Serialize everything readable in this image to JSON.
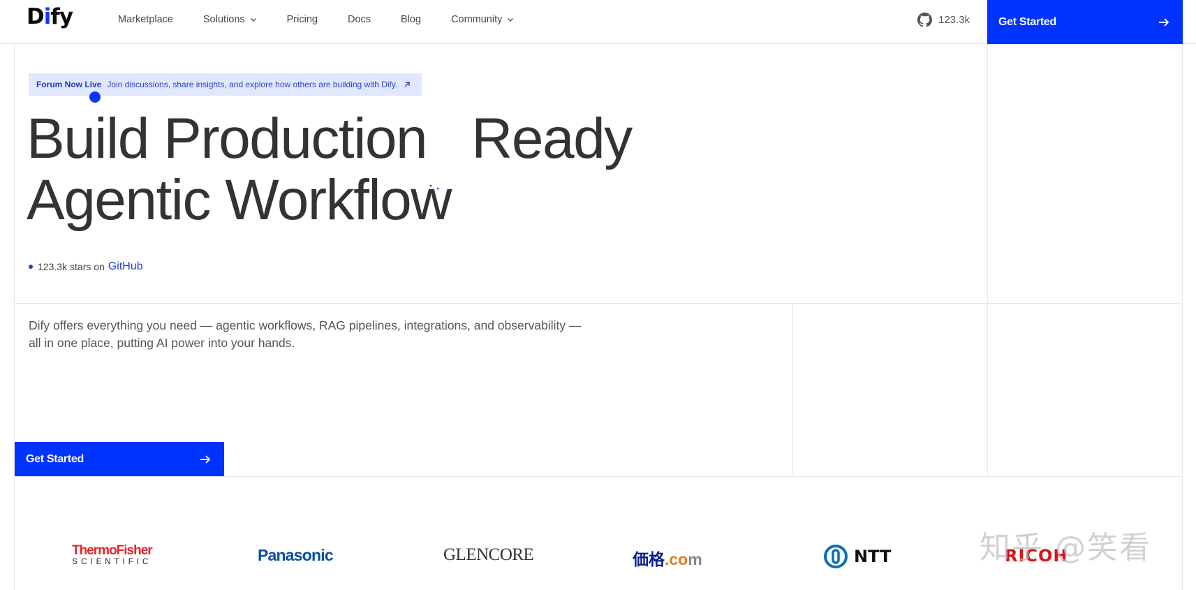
{
  "nav": {
    "logo": {
      "prefix": "D",
      "accent": "i",
      "suffix": "fy"
    },
    "links": [
      {
        "label": "Marketplace",
        "dropdown": false
      },
      {
        "label": "Solutions",
        "dropdown": true
      },
      {
        "label": "Pricing",
        "dropdown": false
      },
      {
        "label": "Docs",
        "dropdown": false
      },
      {
        "label": "Blog",
        "dropdown": false
      },
      {
        "label": "Community",
        "dropdown": true
      }
    ],
    "github_stars": "123.3k",
    "cta_label": "Get Started"
  },
  "announcement": {
    "badge": "Forum Now Live",
    "text": "Join discussions, share insights, and explore how others are building with Dify."
  },
  "hero": {
    "headline_part1": "Build Production",
    "headline_part2": "Ready",
    "headline_line2": "Agentic Workflow",
    "stars_count": "123.3k",
    "stars_text": "stars on",
    "stars_link": "GitHub",
    "description": "Dify offers everything you need — agentic workflows, RAG pipelines, integrations, and observability — all in one place, putting AI power into your hands.",
    "cta_label": "Get Started"
  },
  "logos": {
    "thermo_top": "ThermoFisher",
    "thermo_bottom": "SCIENTIFIC",
    "panasonic": "Panasonic",
    "glencore": "GLENCORE",
    "kakaku_a": "価格",
    "kakaku_b": ".co",
    "kakaku_c": "m",
    "ntt": "NTT",
    "ricoh": "RICOH"
  },
  "watermark": "知乎 @笑看",
  "colors": {
    "accent": "#0033ff",
    "announcement_bg": "#e1e7fd",
    "link": "#1f3fd1"
  }
}
